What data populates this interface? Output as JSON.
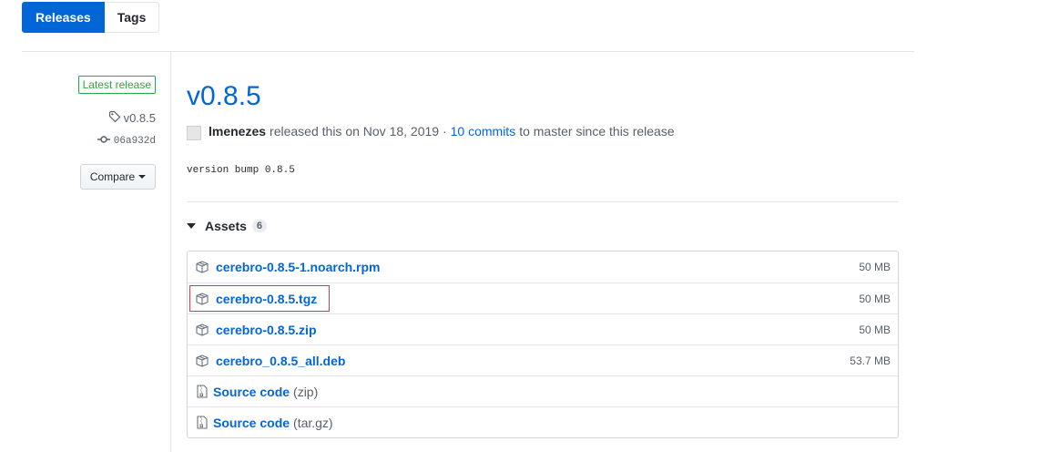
{
  "tabs": [
    {
      "label": "Releases",
      "active": true
    },
    {
      "label": "Tags",
      "active": false
    }
  ],
  "sidebar": {
    "badge": "Latest release",
    "tag": "v0.8.5",
    "commit": "06a932d",
    "compare_label": "Compare"
  },
  "release": {
    "title": "v0.8.5",
    "author": "lmenezes",
    "released_text": "released this on Nov 18, 2019 ·",
    "commits_link": "10 commits",
    "to_master_text": "to master since this release",
    "body": "version bump 0.8.5"
  },
  "assets": {
    "heading": "Assets",
    "count": "6",
    "items": [
      {
        "name": "cerebro-0.8.5-1.noarch.rpm",
        "size": "50 MB",
        "icon": "package-icon"
      },
      {
        "name": "cerebro-0.8.5.tgz",
        "size": "50 MB",
        "icon": "package-icon",
        "highlighted": true
      },
      {
        "name": "cerebro-0.8.5.zip",
        "size": "50 MB",
        "icon": "package-icon"
      },
      {
        "name": "cerebro_0.8.5_all.deb",
        "size": "53.7 MB",
        "icon": "package-icon"
      },
      {
        "name": "Source code",
        "suffix": "(zip)",
        "icon": "file-zip-icon"
      },
      {
        "name": "Source code",
        "suffix": "(tar.gz)",
        "icon": "file-zip-icon"
      }
    ]
  },
  "colors": {
    "accent": "#0366d6",
    "badge_green": "#28a745",
    "highlight_red": "#d73a49"
  }
}
